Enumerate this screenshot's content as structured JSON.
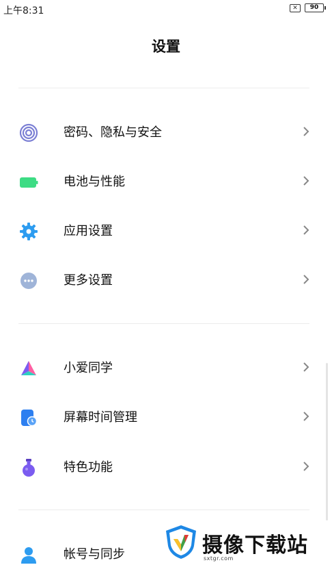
{
  "status_bar": {
    "time": "上午8:31",
    "sim_glyph": "✕",
    "battery_level": "90"
  },
  "header": {
    "title": "设置"
  },
  "sections": [
    {
      "items": [
        {
          "label": "密码、隐私与安全",
          "icon": "fingerprint-icon",
          "color": "#7b7fd4"
        },
        {
          "label": "电池与性能",
          "icon": "battery-icon",
          "color": "#3ddc84"
        },
        {
          "label": "应用设置",
          "icon": "gear-icon",
          "color": "#2d9cf0"
        },
        {
          "label": "更多设置",
          "icon": "more-icon",
          "color": "#9fb4d8"
        }
      ]
    },
    {
      "items": [
        {
          "label": "小爱同学",
          "icon": "xiaoai-icon",
          "color": "#ff5fa2"
        },
        {
          "label": "屏幕时间管理",
          "icon": "screen-time-icon",
          "color": "#2d7ff0"
        },
        {
          "label": "特色功能",
          "icon": "flask-icon",
          "color": "#7b5cf0"
        }
      ]
    },
    {
      "items": [
        {
          "label": "帐号与同步",
          "icon": "account-icon",
          "color": "#2d9cf0"
        }
      ]
    }
  ],
  "watermark": {
    "brand": "摄像下载站",
    "url": "sxtgr.com"
  }
}
